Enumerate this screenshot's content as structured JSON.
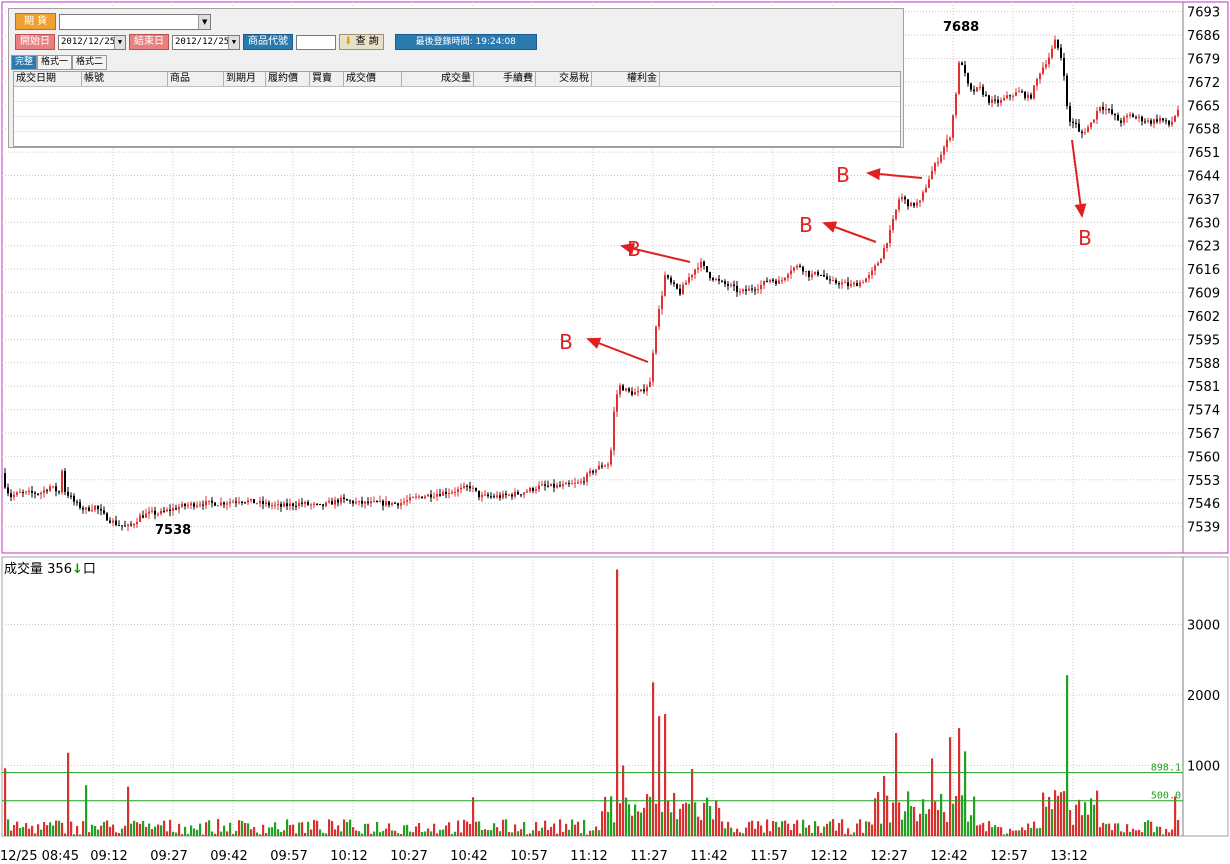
{
  "query_panel": {
    "market_label": "期 貨",
    "start_label": "開始日",
    "start_date": "2012/12/25",
    "end_label": "結束日",
    "end_date": "2012/12/25",
    "product_code_label": "商品代號",
    "query_button": "查 詢",
    "last_login": "最後登錄時間: 19:24:08",
    "tabs": [
      "完整",
      "格式一",
      "格式二"
    ],
    "columns": [
      "成交日期",
      "帳號",
      "商品",
      "到期月",
      "履約價",
      "買賣",
      "成交價",
      "成交量",
      "手續費",
      "交易稅",
      "權利金"
    ]
  },
  "volume_label": "成交量",
  "volume_value": "356",
  "volume_unit": "口",
  "volume_arrow_icon": "down-arrow-icon",
  "colors": {
    "up": "#e03030",
    "down": "#000000",
    "vol_up": "#d83030",
    "vol_down": "#22a022",
    "border": "#c030c0",
    "annotation": "#e02020"
  },
  "chart_data": [
    {
      "type": "candlestick",
      "title": "",
      "x_labels": [
        "12/25 08:45",
        "09:12",
        "09:27",
        "09:42",
        "09:57",
        "10:12",
        "10:27",
        "10:42",
        "10:57",
        "11:12",
        "11:27",
        "11:42",
        "11:57",
        "12:12",
        "12:27",
        "12:42",
        "12:57",
        "13:12"
      ],
      "y_ticks": [
        7539,
        7546,
        7553,
        7560,
        7567,
        7574,
        7581,
        7588,
        7595,
        7602,
        7609,
        7616,
        7623,
        7630,
        7637,
        7644,
        7651,
        7658,
        7665,
        7672,
        7679,
        7686,
        7693
      ],
      "ylim": [
        7532,
        7695
      ],
      "annotations": [
        {
          "text": "7538",
          "kind": "low",
          "value": 7538
        },
        {
          "text": "7688",
          "kind": "high",
          "value": 7688
        },
        {
          "text": "B",
          "kind": "buy"
        },
        {
          "text": "B",
          "kind": "buy"
        },
        {
          "text": "B",
          "kind": "buy"
        },
        {
          "text": "B",
          "kind": "buy"
        },
        {
          "text": "B",
          "kind": "buy"
        }
      ],
      "price_path": [
        [
          0,
          7555
        ],
        [
          10,
          7548
        ],
        [
          20,
          7549
        ],
        [
          30,
          7549
        ],
        [
          40,
          7549
        ],
        [
          50,
          7551
        ],
        [
          60,
          7549
        ],
        [
          62,
          7556
        ],
        [
          64,
          7550
        ],
        [
          70,
          7548
        ],
        [
          75,
          7546
        ],
        [
          85,
          7544
        ],
        [
          95,
          7545
        ],
        [
          105,
          7542
        ],
        [
          115,
          7540
        ],
        [
          125,
          7539
        ],
        [
          130,
          7539
        ],
        [
          140,
          7542
        ],
        [
          150,
          7543
        ],
        [
          160,
          7543
        ],
        [
          180,
          7545
        ],
        [
          200,
          7546
        ],
        [
          220,
          7546
        ],
        [
          240,
          7547
        ],
        [
          260,
          7546
        ],
        [
          280,
          7545
        ],
        [
          300,
          7546
        ],
        [
          320,
          7545
        ],
        [
          340,
          7547
        ],
        [
          360,
          7546
        ],
        [
          380,
          7546
        ],
        [
          400,
          7546
        ],
        [
          420,
          7548
        ],
        [
          440,
          7549
        ],
        [
          460,
          7550
        ],
        [
          470,
          7551
        ],
        [
          480,
          7548
        ],
        [
          500,
          7548
        ],
        [
          520,
          7549
        ],
        [
          540,
          7551
        ],
        [
          560,
          7551
        ],
        [
          580,
          7552
        ],
        [
          590,
          7555
        ],
        [
          600,
          7557
        ],
        [
          610,
          7558
        ],
        [
          615,
          7577
        ],
        [
          620,
          7581
        ],
        [
          630,
          7579
        ],
        [
          640,
          7579
        ],
        [
          650,
          7582
        ],
        [
          655,
          7598
        ],
        [
          660,
          7605
        ],
        [
          665,
          7614
        ],
        [
          670,
          7612
        ],
        [
          680,
          7609
        ],
        [
          690,
          7614
        ],
        [
          700,
          7618
        ],
        [
          710,
          7614
        ],
        [
          720,
          7612
        ],
        [
          730,
          7611
        ],
        [
          740,
          7609
        ],
        [
          750,
          7610
        ],
        [
          760,
          7611
        ],
        [
          770,
          7613
        ],
        [
          780,
          7612
        ],
        [
          790,
          7616
        ],
        [
          800,
          7617
        ],
        [
          810,
          7614
        ],
        [
          820,
          7615
        ],
        [
          830,
          7612
        ],
        [
          840,
          7612
        ],
        [
          850,
          7611
        ],
        [
          860,
          7612
        ],
        [
          870,
          7614
        ],
        [
          880,
          7619
        ],
        [
          890,
          7627
        ],
        [
          900,
          7638
        ],
        [
          910,
          7635
        ],
        [
          920,
          7636
        ],
        [
          930,
          7644
        ],
        [
          940,
          7650
        ],
        [
          950,
          7656
        ],
        [
          955,
          7666
        ],
        [
          960,
          7680
        ],
        [
          965,
          7674
        ],
        [
          970,
          7669
        ],
        [
          980,
          7670
        ],
        [
          990,
          7666
        ],
        [
          1000,
          7666
        ],
        [
          1010,
          7668
        ],
        [
          1020,
          7669
        ],
        [
          1030,
          7667
        ],
        [
          1040,
          7675
        ],
        [
          1050,
          7680
        ],
        [
          1055,
          7684
        ],
        [
          1060,
          7681
        ],
        [
          1065,
          7673
        ],
        [
          1068,
          7660
        ],
        [
          1075,
          7660
        ],
        [
          1080,
          7656
        ],
        [
          1090,
          7659
        ],
        [
          1100,
          7665
        ],
        [
          1110,
          7663
        ],
        [
          1120,
          7660
        ],
        [
          1130,
          7662
        ],
        [
          1140,
          7661
        ],
        [
          1150,
          7660
        ],
        [
          1160,
          7661
        ],
        [
          1170,
          7659
        ],
        [
          1180,
          7665
        ]
      ]
    },
    {
      "type": "bar",
      "title": "成交量",
      "y_ticks": [
        1000,
        2000,
        3000
      ],
      "ylim": [
        0,
        3900
      ],
      "reference_lines": [
        {
          "label": "898.1",
          "value": 898.1
        },
        {
          "label": "500.0",
          "value": 500.0
        }
      ],
      "spikes": [
        {
          "x": 5,
          "value": 960,
          "up": true
        },
        {
          "x": 68,
          "value": 1180,
          "up": true
        },
        {
          "x": 85,
          "value": 720,
          "up": false
        },
        {
          "x": 128,
          "value": 700,
          "up": true
        },
        {
          "x": 473,
          "value": 550,
          "up": true
        },
        {
          "x": 616,
          "value": 3780,
          "up": true
        },
        {
          "x": 622,
          "value": 1000,
          "up": true
        },
        {
          "x": 652,
          "value": 2180,
          "up": true
        },
        {
          "x": 658,
          "value": 1700,
          "up": true
        },
        {
          "x": 665,
          "value": 1730,
          "up": true
        },
        {
          "x": 692,
          "value": 950,
          "up": true
        },
        {
          "x": 885,
          "value": 850,
          "up": true
        },
        {
          "x": 896,
          "value": 1460,
          "up": true
        },
        {
          "x": 932,
          "value": 1100,
          "up": true
        },
        {
          "x": 950,
          "value": 1400,
          "up": true
        },
        {
          "x": 960,
          "value": 1530,
          "up": true
        },
        {
          "x": 965,
          "value": 1200,
          "up": false
        },
        {
          "x": 1066,
          "value": 2280,
          "up": false
        },
        {
          "x": 1055,
          "value": 650,
          "up": true
        },
        {
          "x": 1175,
          "value": 560,
          "up": true
        }
      ]
    }
  ]
}
